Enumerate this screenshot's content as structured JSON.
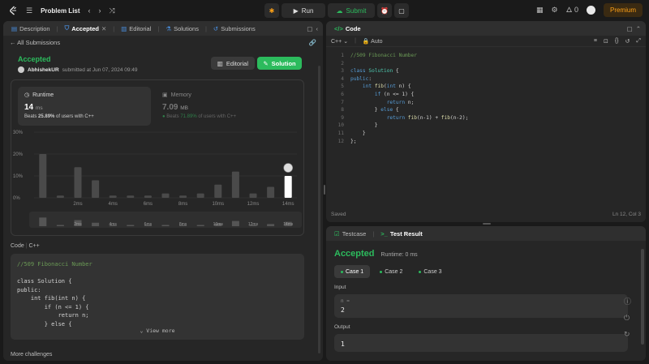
{
  "topbar": {
    "problem_list": "Problem List",
    "run": "Run",
    "submit": "Submit",
    "streak": "0",
    "premium": "Premium"
  },
  "left_tabs": [
    {
      "label": "Description",
      "active": false
    },
    {
      "label": "Accepted",
      "active": true
    },
    {
      "label": "Editorial",
      "active": false
    },
    {
      "label": "Solutions",
      "active": false
    },
    {
      "label": "Submissions",
      "active": false
    }
  ],
  "sub_nav": {
    "back": "All Submissions"
  },
  "submission": {
    "status": "Accepted",
    "author": "AbhishekUR",
    "submitted_text": "submitted at Jun 07, 2024 09:49",
    "editorial_btn": "Editorial",
    "solution_btn": "Solution"
  },
  "runtime": {
    "label": "Runtime",
    "value": "14",
    "unit": "ms",
    "beats_prefix": "Beats",
    "beats_pct": "25.89%",
    "beats_suffix": "of users with C++"
  },
  "memory": {
    "label": "Memory",
    "value": "7.09",
    "unit": "MB",
    "beats_prefix": "Beats",
    "beats_pct": "71.89%",
    "beats_suffix": "of users with C++"
  },
  "chart_data": {
    "type": "bar",
    "yticks": [
      "30%",
      "20%",
      "10%",
      "0%"
    ],
    "ylim": [
      0,
      30
    ],
    "xtick_labels": [
      "2ms",
      "4ms",
      "6ms",
      "8ms",
      "10ms",
      "12ms",
      "14ms"
    ],
    "values": [
      20,
      1,
      14,
      8,
      1,
      1,
      1,
      2,
      1,
      2,
      6,
      12,
      2,
      5,
      10
    ],
    "highlight_index": 14,
    "colors": {
      "bar": "#4a4a4a",
      "highlight": "#ffffff",
      "grid": "#3a3a3a"
    }
  },
  "code_section": {
    "label": "Code",
    "lang": "C++",
    "preview_lines": [
      "//509 Fibonacci Number",
      "",
      "class Solution {",
      "public:",
      "    int fib(int n) {",
      "        if (n <= 1) {",
      "            return n;",
      "        } else {"
    ],
    "view_more": "View more",
    "more_challenges": "More challenges"
  },
  "editor": {
    "tab": "Code",
    "lang": "C++",
    "auto": "Auto",
    "line_numbers": [
      "1",
      "2",
      "3",
      "4",
      "5",
      "6",
      "7",
      "8",
      "9",
      "10",
      "11",
      "12"
    ],
    "saved": "Saved",
    "cursor": "Ln 12, Col 3"
  },
  "test": {
    "tab_testcase": "Testcase",
    "tab_result": "Test Result",
    "status": "Accepted",
    "runtime": "Runtime: 0 ms",
    "cases": [
      "Case 1",
      "Case 2",
      "Case 3"
    ],
    "input_label": "Input",
    "input_var": "n =",
    "input_val": "2",
    "output_label": "Output",
    "output_val": "1"
  }
}
